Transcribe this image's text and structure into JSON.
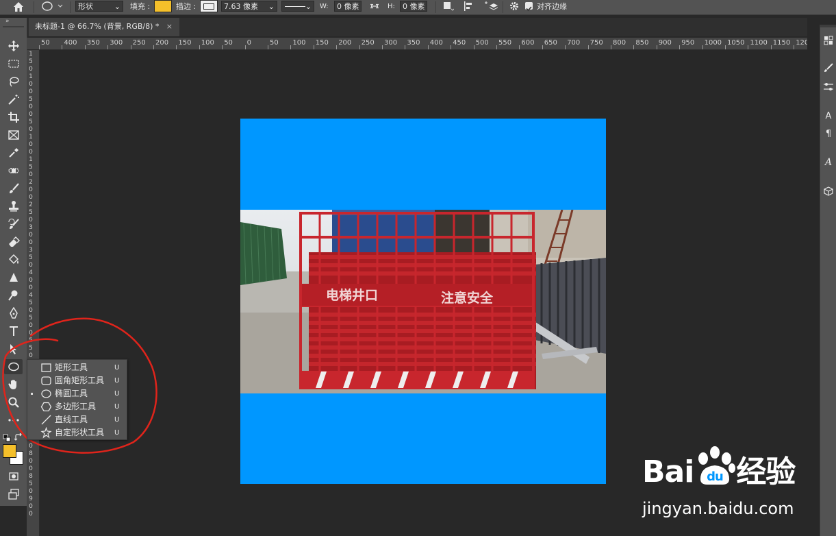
{
  "options_bar": {
    "mode_value": "形状",
    "fill_label": "填充 :",
    "fill_color": "#f5c02a",
    "stroke_label": "描边 :",
    "stroke_width_value": "7.63 像素",
    "w_label": "W:",
    "w_value": "0 像素",
    "h_label": "H:",
    "h_value": "0 像素",
    "align_edges_label": "对齐边缘",
    "align_edges_checked": true
  },
  "document_tab": {
    "title": "未标题-1 @ 66.7% (背景, RGB/8) *",
    "close_glyph": "×"
  },
  "ruler": {
    "horizontal_ticks": [
      "50",
      "400",
      "350",
      "300",
      "250",
      "200",
      "150",
      "100",
      "50",
      "0",
      "50",
      "100",
      "150",
      "200",
      "250",
      "300",
      "350",
      "400",
      "450",
      "500",
      "550",
      "600",
      "650",
      "700",
      "750",
      "800",
      "850",
      "900",
      "950",
      "1000",
      "1050",
      "1100",
      "1150",
      "1200"
    ],
    "vertical_ticks": [
      "1",
      "5",
      "0",
      "1",
      "0",
      "0",
      "5",
      "0",
      "0",
      "5",
      "0",
      "1",
      "0",
      "0",
      "1",
      "5",
      "0",
      "2",
      "0",
      "0",
      "2",
      "5",
      "0",
      "3",
      "0",
      "0",
      "3",
      "5",
      "0",
      "4",
      "0",
      "0",
      "4",
      "5",
      "0",
      "5",
      "0",
      "0",
      "5",
      "5",
      "0",
      "6",
      "0",
      "0",
      "6",
      "5",
      "0",
      "7",
      "0",
      "0",
      "7",
      "5",
      "0",
      "8",
      "0",
      "0",
      "8",
      "5",
      "0",
      "9",
      "0",
      "0"
    ]
  },
  "canvas": {
    "background_color": "#0097ff",
    "photo_sign_left": "电梯井口",
    "photo_sign_right": "注意安全"
  },
  "shape_flyout": {
    "items": [
      {
        "label": "矩形工具",
        "shortcut": "U",
        "icon": "rectangle-icon",
        "selected": false
      },
      {
        "label": "圆角矩形工具",
        "shortcut": "U",
        "icon": "rounded-rectangle-icon",
        "selected": false
      },
      {
        "label": "椭圆工具",
        "shortcut": "U",
        "icon": "ellipse-icon",
        "selected": true
      },
      {
        "label": "多边形工具",
        "shortcut": "U",
        "icon": "polygon-icon",
        "selected": false
      },
      {
        "label": "直线工具",
        "shortcut": "U",
        "icon": "line-icon",
        "selected": false
      },
      {
        "label": "自定形状工具",
        "shortcut": "U",
        "icon": "custom-shape-icon",
        "selected": false
      }
    ]
  },
  "swatches": {
    "foreground": "#f5c02a",
    "background": "#ffffff"
  },
  "watermark": {
    "logo_text_1": "Bai",
    "logo_text_2": "经验",
    "url": "jingyan.baidu.com"
  },
  "annotation_color": "#e0241b"
}
